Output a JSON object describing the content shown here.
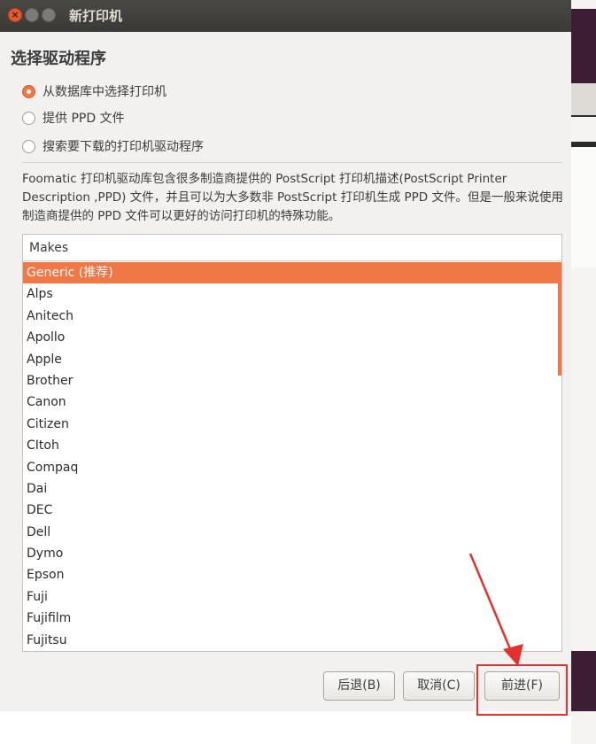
{
  "window": {
    "title": "新打印机"
  },
  "page": {
    "heading": "选择驱动程序"
  },
  "options": [
    {
      "label": "从数据库中选择打印机",
      "checked": true
    },
    {
      "label": "提供 PPD 文件",
      "checked": false
    },
    {
      "label": "搜索要下载的打印机驱动程序",
      "checked": false
    }
  ],
  "description": "Foomatic 打印机驱动库包含很多制造商提供的 PostScript 打印机描述(PostScript Printer Description ,PPD) 文件，并且可以为大多数非 PostScript 打印机生成 PPD 文件。但是一般来说使用制造商提供的 PPD 文件可以更好的访问打印机的特殊功能。",
  "makes_list": {
    "header": "Makes",
    "items": [
      "Generic (推荐)",
      "Alps",
      "Anitech",
      "Apollo",
      "Apple",
      "Brother",
      "Canon",
      "Citizen",
      "CItoh",
      "Compaq",
      "Dai",
      "DEC",
      "Dell",
      "Dymo",
      "Epson",
      "Fuji",
      "Fujifilm",
      "Fujitsu"
    ],
    "selected_index": 0
  },
  "buttons": {
    "back": "后退(B)",
    "cancel": "取消(C)",
    "forward": "前进(F)"
  },
  "colors": {
    "accent": "#f07746",
    "annotation": "#e3312e"
  },
  "icons": {
    "close": "close-icon",
    "minimize": "minimize-icon",
    "maximize": "maximize-icon"
  }
}
